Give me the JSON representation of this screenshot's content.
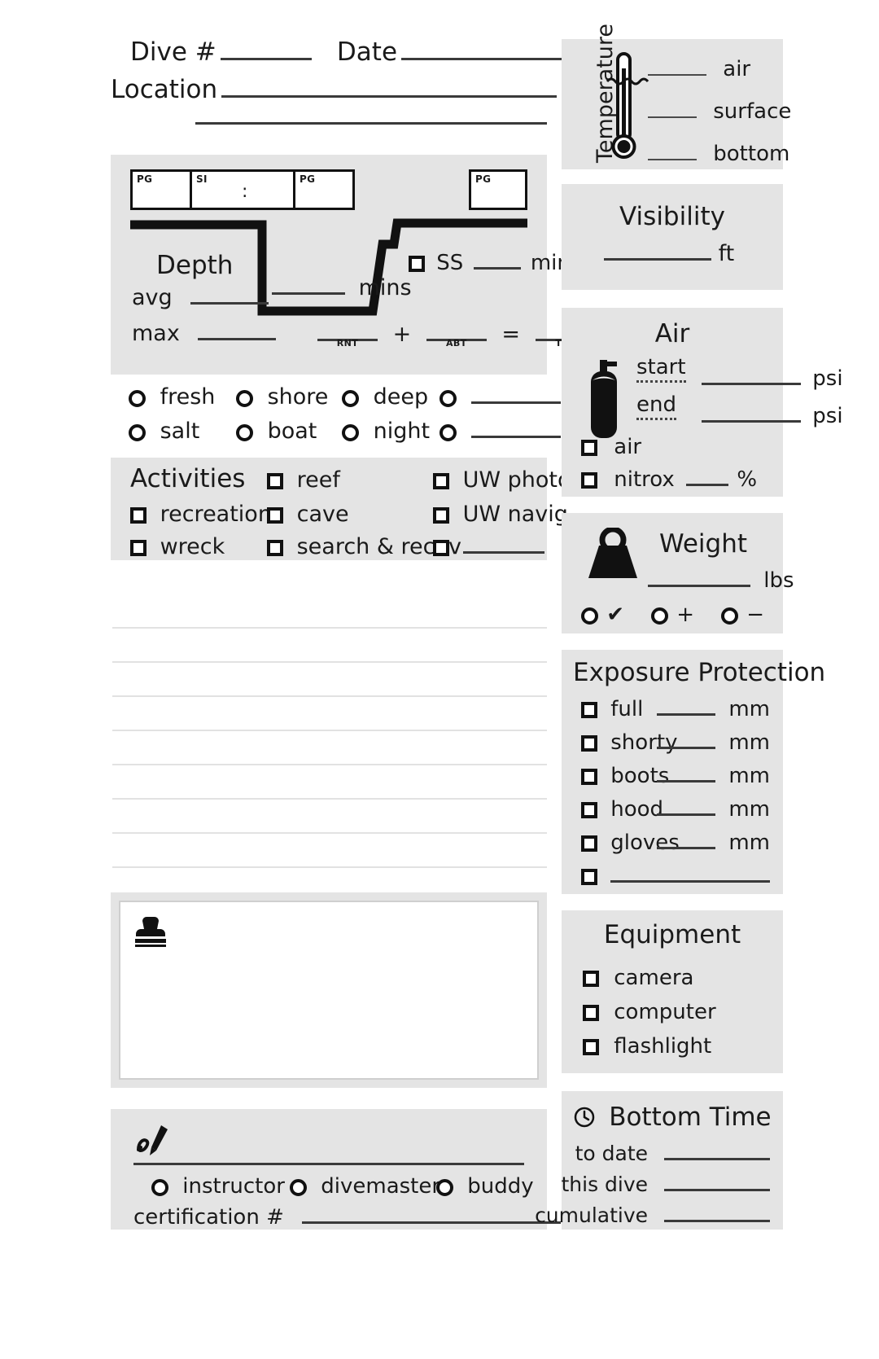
{
  "header": {
    "dive_label": "Dive #",
    "date_label": "Date",
    "location_label": "Location"
  },
  "depth": {
    "pg_tag": "PG",
    "si_tag": "SI",
    "si_colon": ":",
    "pg_tag_2": "PG",
    "pg_tag_3": "PG",
    "title": "Depth",
    "avg_label": "avg",
    "max_label": "max",
    "mins_label": "mins",
    "ss_label": "SS",
    "ss_mins_label": "mins",
    "plus": "+",
    "equals": "=",
    "rnt": "RNT",
    "abt": "ABT",
    "tbt": "TBT"
  },
  "conditions": {
    "row1": [
      "fresh",
      "shore",
      "deep",
      ""
    ],
    "row2": [
      "salt",
      "boat",
      "night",
      ""
    ]
  },
  "activities": {
    "title": "Activities",
    "col1": [
      "recreation",
      "wreck"
    ],
    "col2": [
      "reef",
      "cave",
      "search & recov"
    ],
    "col3": [
      "UW photo",
      "UW navig",
      ""
    ]
  },
  "stamp": {
    "icon": "stamp-icon"
  },
  "signature": {
    "icon": "signature-pen-icon",
    "roles": [
      "instructor",
      "divemaster",
      "buddy"
    ],
    "cert_label": "certification #"
  },
  "temperature": {
    "title": "Temperature",
    "icon": "thermometer-icon",
    "rows": [
      "air",
      "surface",
      "bottom"
    ]
  },
  "visibility": {
    "title": "Visibility",
    "unit": "ft"
  },
  "air": {
    "title": "Air",
    "icon": "scuba-tank-icon",
    "start_label": "start",
    "end_label": "end",
    "psi_label": "psi",
    "checkboxes": [
      "air",
      "nitrox"
    ],
    "nitrox_unit": "%"
  },
  "weight": {
    "title": "Weight",
    "icon": "weight-icon",
    "unit": "lbs",
    "options": [
      "✔",
      "+",
      "−"
    ]
  },
  "exposure": {
    "title": "Exposure Protection",
    "rows": [
      {
        "label": "full",
        "unit": "mm"
      },
      {
        "label": "shorty",
        "unit": "mm"
      },
      {
        "label": "boots",
        "unit": "mm"
      },
      {
        "label": "hood",
        "unit": "mm"
      },
      {
        "label": "gloves",
        "unit": "mm"
      },
      {
        "label": "",
        "unit": ""
      }
    ]
  },
  "equipment": {
    "title": "Equipment",
    "rows": [
      "camera",
      "computer",
      "flashlight"
    ]
  },
  "bottom_time": {
    "title": "Bottom Time",
    "icon": "clock-icon",
    "rows": [
      "to date",
      "this dive",
      "cumulative"
    ]
  },
  "colors": {
    "panel_bg": "#e4e4e4",
    "ink": "#111111",
    "rule": "#3a3a3a",
    "faint_rule": "#e2e2e2",
    "page_bg": "#ffffff"
  }
}
